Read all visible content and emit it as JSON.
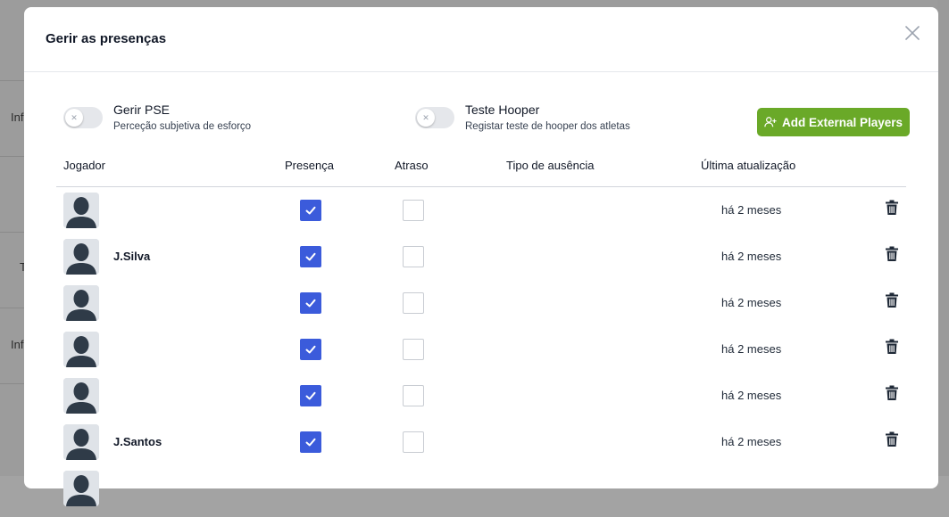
{
  "modal": {
    "title": "Gerir as presenças"
  },
  "background": {
    "fragments": [
      "Inf",
      "T",
      "Inf"
    ]
  },
  "toggles": [
    {
      "title": "Gerir PSE",
      "subtitle": "Perceção subjetiva de esforço",
      "on": false
    },
    {
      "title": "Teste Hooper",
      "subtitle": "Registar teste de hooper dos atletas",
      "on": false
    }
  ],
  "add_button": {
    "label": "Add External Players",
    "color": "#6aa928"
  },
  "table": {
    "headers": {
      "player": "Jogador",
      "presence": "Presença",
      "delay": "Atraso",
      "absence_type": "Tipo de ausência",
      "last_update": "Última atualização"
    },
    "rows": [
      {
        "name": "",
        "presence": true,
        "delay": false,
        "absence_type": "",
        "updated": "há 2 meses"
      },
      {
        "name": "J.Silva",
        "presence": true,
        "delay": false,
        "absence_type": "",
        "updated": "há 2 meses"
      },
      {
        "name": "",
        "presence": true,
        "delay": false,
        "absence_type": "",
        "updated": "há 2 meses"
      },
      {
        "name": "",
        "presence": true,
        "delay": false,
        "absence_type": "",
        "updated": "há 2 meses"
      },
      {
        "name": "",
        "presence": true,
        "delay": false,
        "absence_type": "",
        "updated": "há 2 meses"
      },
      {
        "name": "J.Santos",
        "presence": true,
        "delay": false,
        "absence_type": "",
        "updated": "há 2 meses"
      }
    ]
  },
  "colors": {
    "accent_checkbox": "#3b5bdb",
    "add_button": "#6aa928"
  },
  "icons": {
    "close": "close-icon",
    "add_user": "add-user-icon",
    "delete": "trash-icon",
    "avatar": "avatar-placeholder-icon"
  }
}
